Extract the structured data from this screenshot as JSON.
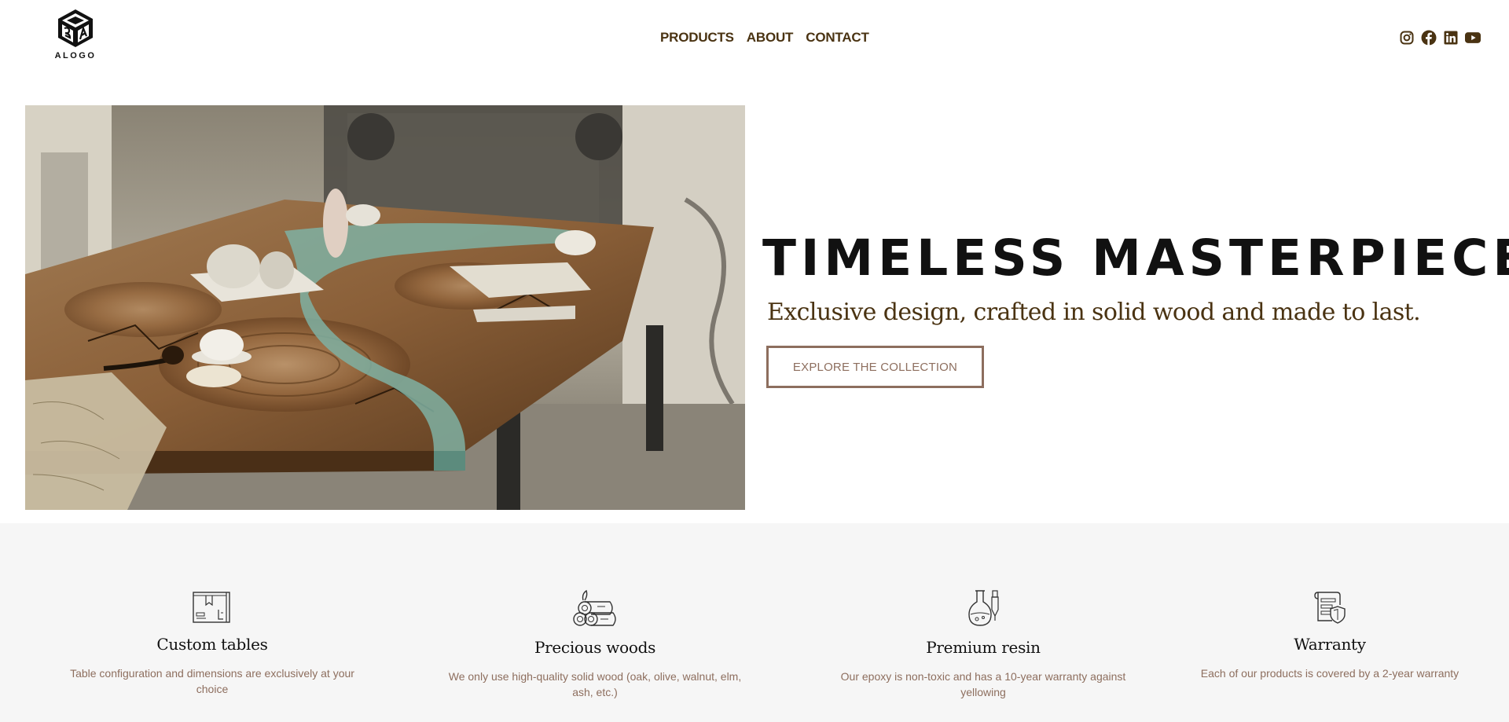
{
  "brand": {
    "logo_text": "ALOGO"
  },
  "nav": {
    "items": [
      {
        "label": "PRODUCTS"
      },
      {
        "label": "ABOUT"
      },
      {
        "label": "CONTACT"
      }
    ]
  },
  "social": {
    "icons": [
      "instagram-icon",
      "facebook-icon",
      "linkedin-icon",
      "youtube-icon"
    ]
  },
  "hero": {
    "title": "TIMELESS MASTERPIECES",
    "subtitle": "Exclusive design, crafted in solid wood and made to last.",
    "cta_label": "EXPLORE THE COLLECTION"
  },
  "features": [
    {
      "title": "Custom tables",
      "description": "Table configuration and dimensions are exclusively at your choice",
      "icon": "blueprint-icon"
    },
    {
      "title": "Precious woods",
      "description": "We only use high-quality solid wood (oak, olive, walnut, elm, ash, etc.)",
      "icon": "logs-icon"
    },
    {
      "title": "Premium resin",
      "description": "Our epoxy is non-toxic and has a 10-year warranty against yellowing",
      "icon": "flask-icon"
    },
    {
      "title": "Warranty",
      "description": "Each of our products is covered by a 2-year warranty",
      "icon": "shield-document-icon"
    }
  ],
  "colors": {
    "text_brown": "#4a3312",
    "accent_brown": "#8d6e5e",
    "features_bg": "#f6f6f6"
  }
}
